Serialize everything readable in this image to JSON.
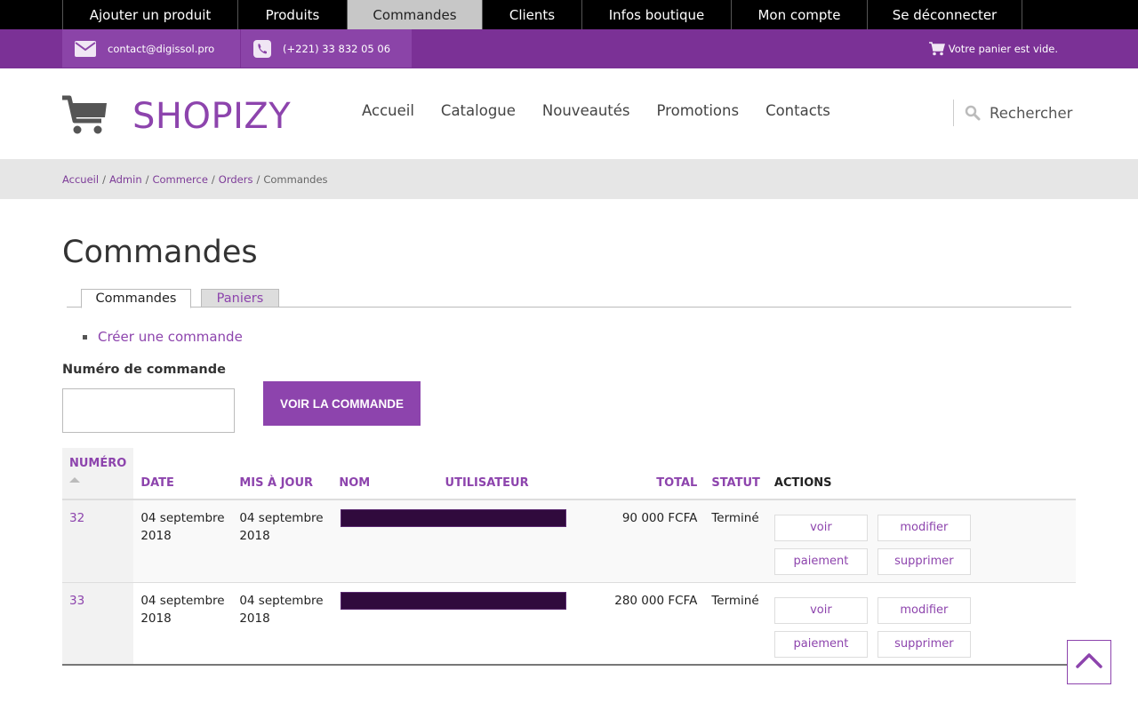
{
  "admin_bar": {
    "items": [
      {
        "label": "Ajouter un produit",
        "active": false
      },
      {
        "label": "Produits",
        "active": false
      },
      {
        "label": "Commandes",
        "active": true
      },
      {
        "label": "Clients",
        "active": false
      },
      {
        "label": "Infos boutique",
        "active": false
      },
      {
        "label": "Mon compte",
        "active": false
      },
      {
        "label": "Se déconnecter",
        "active": false
      }
    ]
  },
  "contact_bar": {
    "email": "contact@digissol.pro",
    "phone": "(+221) 33 832 05 06",
    "cart_status": "Votre panier est vide."
  },
  "header": {
    "brand": "SHOPIZY",
    "nav": [
      "Accueil",
      "Catalogue",
      "Nouveautés",
      "Promotions",
      "Contacts"
    ],
    "search_label": "Rechercher"
  },
  "breadcrumb": {
    "links": [
      "Accueil",
      "Admin",
      "Commerce",
      "Orders"
    ],
    "current": "Commandes",
    "separator": "/"
  },
  "page": {
    "title": "Commandes",
    "tabs": [
      {
        "label": "Commandes",
        "active": true
      },
      {
        "label": "Paniers",
        "active": false
      }
    ],
    "action_links": [
      "Créer une commande"
    ],
    "order_number_label": "Numéro de commande",
    "order_number_value": "",
    "view_order_button": "VOIR LA COMMANDE"
  },
  "table": {
    "headers": {
      "numero": "NUMÉRO",
      "date": "DATE",
      "updated": "MIS À JOUR",
      "name": "NOM",
      "user": "UTILISATEUR",
      "total": "TOTAL",
      "status": "STATUT",
      "actions": "ACTIONS"
    },
    "sort": {
      "column": "numero",
      "direction": "asc"
    },
    "rows": [
      {
        "numero": "32",
        "date": "04 septembre 2018",
        "updated": "04 septembre 2018",
        "name": "[redacted]",
        "user": "[redacted]",
        "total": "90 000 FCFA",
        "status": "Terminé"
      },
      {
        "numero": "33",
        "date": "04 septembre 2018",
        "updated": "04 septembre 2018",
        "name": "[redacted]",
        "user": "[redacted]",
        "total": "280 000 FCFA",
        "status": "Terminé"
      }
    ],
    "row_actions": [
      "voir",
      "modifier",
      "paiement",
      "supprimer"
    ]
  },
  "colors": {
    "brand_purple": "#8d44ad",
    "contact_bar": "#7b3196",
    "admin_bar": "#000000",
    "active_tab": "#c7c7c7",
    "redaction": "#300a3d"
  }
}
